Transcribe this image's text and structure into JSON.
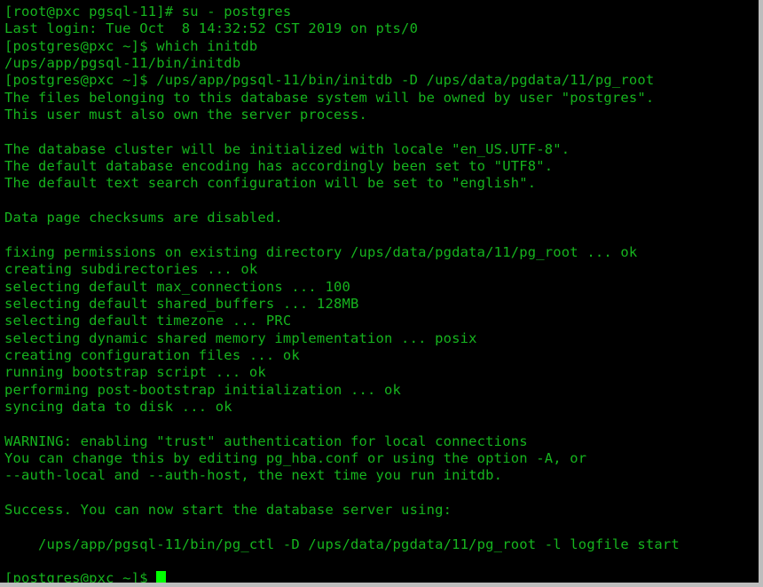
{
  "terminal": {
    "colors": {
      "background": "#000000",
      "foreground": "#16b41e",
      "cursor": "#00ff00",
      "window_border": "#bdbdbd"
    },
    "lines": [
      "[root@pxc pgsql-11]# su - postgres",
      "Last login: Tue Oct  8 14:32:52 CST 2019 on pts/0",
      "[postgres@pxc ~]$ which initdb",
      "/ups/app/pgsql-11/bin/initdb",
      "[postgres@pxc ~]$ /ups/app/pgsql-11/bin/initdb -D /ups/data/pgdata/11/pg_root",
      "The files belonging to this database system will be owned by user \"postgres\".",
      "This user must also own the server process.",
      "",
      "The database cluster will be initialized with locale \"en_US.UTF-8\".",
      "The default database encoding has accordingly been set to \"UTF8\".",
      "The default text search configuration will be set to \"english\".",
      "",
      "Data page checksums are disabled.",
      "",
      "fixing permissions on existing directory /ups/data/pgdata/11/pg_root ... ok",
      "creating subdirectories ... ok",
      "selecting default max_connections ... 100",
      "selecting default shared_buffers ... 128MB",
      "selecting default timezone ... PRC",
      "selecting dynamic shared memory implementation ... posix",
      "creating configuration files ... ok",
      "running bootstrap script ... ok",
      "performing post-bootstrap initialization ... ok",
      "syncing data to disk ... ok",
      "",
      "WARNING: enabling \"trust\" authentication for local connections",
      "You can change this by editing pg_hba.conf or using the option -A, or",
      "--auth-local and --auth-host, the next time you run initdb.",
      "",
      "Success. You can now start the database server using:",
      "",
      "    /ups/app/pgsql-11/bin/pg_ctl -D /ups/data/pgdata/11/pg_root -l logfile start",
      ""
    ],
    "prompt": "[postgres@pxc ~]$ ",
    "cursor_char": " "
  }
}
